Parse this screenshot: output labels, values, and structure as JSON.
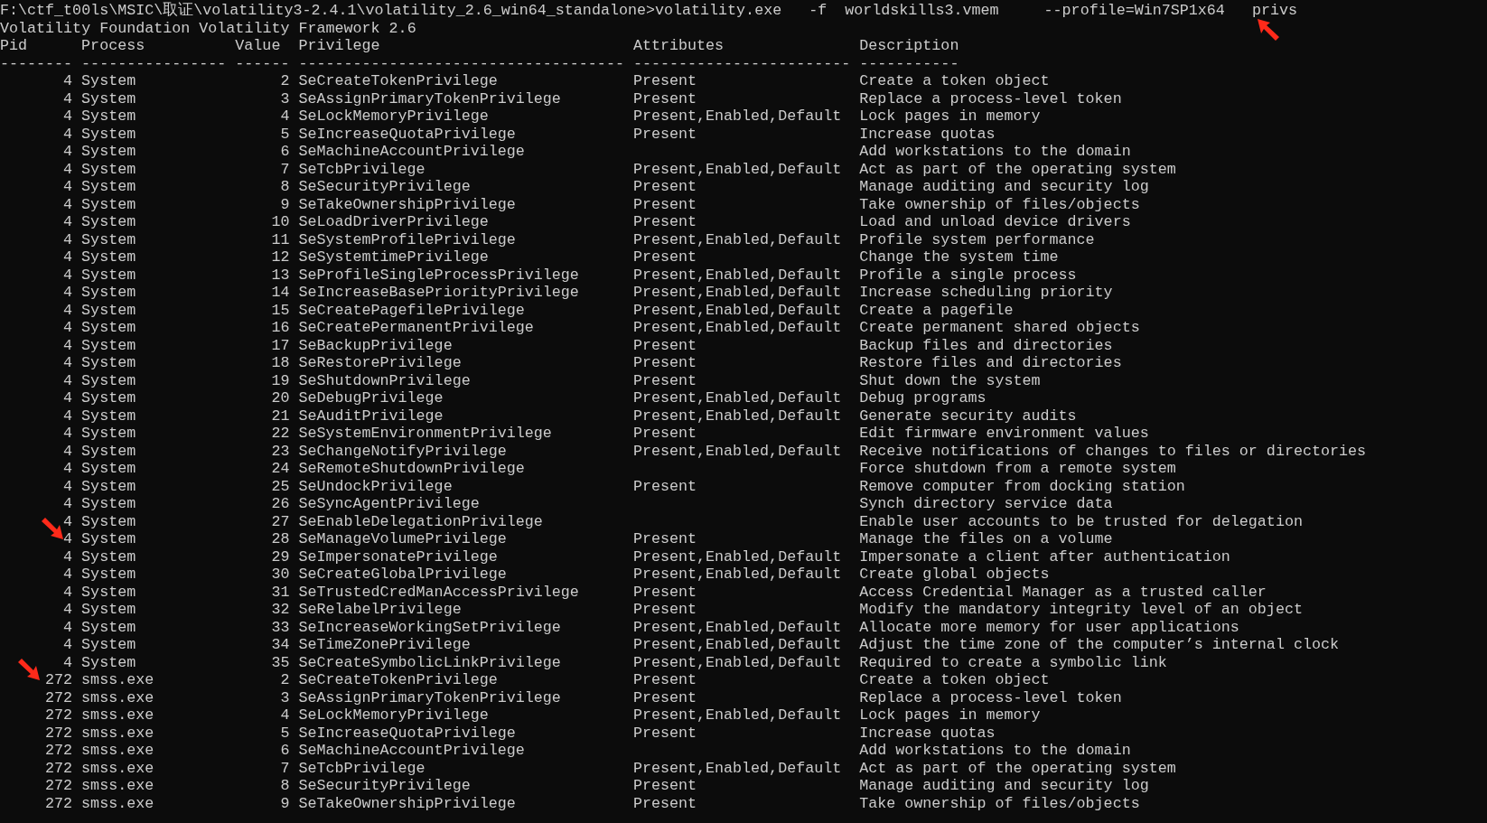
{
  "command": {
    "text": "F:\\ctf_t00ls\\MSIC\\取证\\volatility3-2.4.1\\volatility_2.6_win64_standalone>volatility.exe   -f  worldskills3.vmem     --profile=Win7SP1x64   privs",
    "arrow": true
  },
  "banner": "Volatility Foundation Volatility Framework 2.6",
  "columns": [
    {
      "label": "Pid",
      "rule": "--------"
    },
    {
      "label": "Process",
      "rule": "----------------"
    },
    {
      "label": "Value",
      "rule": "------"
    },
    {
      "label": "Privilege",
      "rule": "------------------------------------"
    },
    {
      "label": "Attributes",
      "rule": "------------------------"
    },
    {
      "label": "Description",
      "rule": "-----------"
    }
  ],
  "rows": [
    {
      "pid": "4",
      "process": "System",
      "value": "2",
      "privilege": "SeCreateTokenPrivilege",
      "attributes": "Present",
      "description": "Create a token object",
      "arrow": false
    },
    {
      "pid": "4",
      "process": "System",
      "value": "3",
      "privilege": "SeAssignPrimaryTokenPrivilege",
      "attributes": "Present",
      "description": "Replace a process-level token",
      "arrow": false
    },
    {
      "pid": "4",
      "process": "System",
      "value": "4",
      "privilege": "SeLockMemoryPrivilege",
      "attributes": "Present,Enabled,Default",
      "description": "Lock pages in memory",
      "arrow": false
    },
    {
      "pid": "4",
      "process": "System",
      "value": "5",
      "privilege": "SeIncreaseQuotaPrivilege",
      "attributes": "Present",
      "description": "Increase quotas",
      "arrow": false
    },
    {
      "pid": "4",
      "process": "System",
      "value": "6",
      "privilege": "SeMachineAccountPrivilege",
      "description": "Add workstations to the domain",
      "arrow": false
    },
    {
      "pid": "4",
      "process": "System",
      "value": "7",
      "privilege": "SeTcbPrivilege",
      "attributes": "Present,Enabled,Default",
      "description": "Act as part of the operating system",
      "arrow": false
    },
    {
      "pid": "4",
      "process": "System",
      "value": "8",
      "privilege": "SeSecurityPrivilege",
      "attributes": "Present",
      "description": "Manage auditing and security log",
      "arrow": false
    },
    {
      "pid": "4",
      "process": "System",
      "value": "9",
      "privilege": "SeTakeOwnershipPrivilege",
      "attributes": "Present",
      "description": "Take ownership of files/objects",
      "arrow": false
    },
    {
      "pid": "4",
      "process": "System",
      "value": "10",
      "privilege": "SeLoadDriverPrivilege",
      "attributes": "Present",
      "description": "Load and unload device drivers",
      "arrow": false
    },
    {
      "pid": "4",
      "process": "System",
      "value": "11",
      "privilege": "SeSystemProfilePrivilege",
      "attributes": "Present,Enabled,Default",
      "description": "Profile system performance",
      "arrow": false
    },
    {
      "pid": "4",
      "process": "System",
      "value": "12",
      "privilege": "SeSystemtimePrivilege",
      "attributes": "Present",
      "description": "Change the system time",
      "arrow": false
    },
    {
      "pid": "4",
      "process": "System",
      "value": "13",
      "privilege": "SeProfileSingleProcessPrivilege",
      "attributes": "Present,Enabled,Default",
      "description": "Profile a single process",
      "arrow": false
    },
    {
      "pid": "4",
      "process": "System",
      "value": "14",
      "privilege": "SeIncreaseBasePriorityPrivilege",
      "attributes": "Present,Enabled,Default",
      "description": "Increase scheduling priority",
      "arrow": false
    },
    {
      "pid": "4",
      "process": "System",
      "value": "15",
      "privilege": "SeCreatePagefilePrivilege",
      "attributes": "Present,Enabled,Default",
      "description": "Create a pagefile",
      "arrow": false
    },
    {
      "pid": "4",
      "process": "System",
      "value": "16",
      "privilege": "SeCreatePermanentPrivilege",
      "attributes": "Present,Enabled,Default",
      "description": "Create permanent shared objects",
      "arrow": false
    },
    {
      "pid": "4",
      "process": "System",
      "value": "17",
      "privilege": "SeBackupPrivilege",
      "attributes": "Present",
      "description": "Backup files and directories",
      "arrow": false
    },
    {
      "pid": "4",
      "process": "System",
      "value": "18",
      "privilege": "SeRestorePrivilege",
      "attributes": "Present",
      "description": "Restore files and directories",
      "arrow": false
    },
    {
      "pid": "4",
      "process": "System",
      "value": "19",
      "privilege": "SeShutdownPrivilege",
      "attributes": "Present",
      "description": "Shut down the system",
      "arrow": false
    },
    {
      "pid": "4",
      "process": "System",
      "value": "20",
      "privilege": "SeDebugPrivilege",
      "attributes": "Present,Enabled,Default",
      "description": "Debug programs",
      "arrow": false
    },
    {
      "pid": "4",
      "process": "System",
      "value": "21",
      "privilege": "SeAuditPrivilege",
      "attributes": "Present,Enabled,Default",
      "description": "Generate security audits",
      "arrow": false
    },
    {
      "pid": "4",
      "process": "System",
      "value": "22",
      "privilege": "SeSystemEnvironmentPrivilege",
      "attributes": "Present",
      "description": "Edit firmware environment values",
      "arrow": false
    },
    {
      "pid": "4",
      "process": "System",
      "value": "23",
      "privilege": "SeChangeNotifyPrivilege",
      "attributes": "Present,Enabled,Default",
      "description": "Receive notifications of changes to files or directories",
      "arrow": false
    },
    {
      "pid": "4",
      "process": "System",
      "value": "24",
      "privilege": "SeRemoteShutdownPrivilege",
      "description": "Force shutdown from a remote system",
      "arrow": false
    },
    {
      "pid": "4",
      "process": "System",
      "value": "25",
      "privilege": "SeUndockPrivilege",
      "attributes": "Present",
      "description": "Remove computer from docking station",
      "arrow": false
    },
    {
      "pid": "4",
      "process": "System",
      "value": "26",
      "privilege": "SeSyncAgentPrivilege",
      "description": "Synch directory service data",
      "arrow": false
    },
    {
      "pid": "4",
      "process": "System",
      "value": "27",
      "privilege": "SeEnableDelegationPrivilege",
      "description": "Enable user accounts to be trusted for delegation",
      "arrow": false
    },
    {
      "pid": "4",
      "process": "System",
      "value": "28",
      "privilege": "SeManageVolumePrivilege",
      "attributes": "Present",
      "description": "Manage the files on a volume",
      "arrow": true
    },
    {
      "pid": "4",
      "process": "System",
      "value": "29",
      "privilege": "SeImpersonatePrivilege",
      "attributes": "Present,Enabled,Default",
      "description": "Impersonate a client after authentication",
      "arrow": false
    },
    {
      "pid": "4",
      "process": "System",
      "value": "30",
      "privilege": "SeCreateGlobalPrivilege",
      "attributes": "Present,Enabled,Default",
      "description": "Create global objects",
      "arrow": false
    },
    {
      "pid": "4",
      "process": "System",
      "value": "31",
      "privilege": "SeTrustedCredManAccessPrivilege",
      "attributes": "Present",
      "description": "Access Credential Manager as a trusted caller",
      "arrow": false
    },
    {
      "pid": "4",
      "process": "System",
      "value": "32",
      "privilege": "SeRelabelPrivilege",
      "attributes": "Present",
      "description": "Modify the mandatory integrity level of an object",
      "arrow": false
    },
    {
      "pid": "4",
      "process": "System",
      "value": "33",
      "privilege": "SeIncreaseWorkingSetPrivilege",
      "attributes": "Present,Enabled,Default",
      "description": "Allocate more memory for user applications",
      "arrow": false
    },
    {
      "pid": "4",
      "process": "System",
      "value": "34",
      "privilege": "SeTimeZonePrivilege",
      "attributes": "Present,Enabled,Default",
      "description": "Adjust the time zone of the computer’s internal clock",
      "arrow": false
    },
    {
      "pid": "4",
      "process": "System",
      "value": "35",
      "privilege": "SeCreateSymbolicLinkPrivilege",
      "attributes": "Present,Enabled,Default",
      "description": "Required to create a symbolic link",
      "arrow": false
    },
    {
      "pid": "272",
      "process": "smss.exe",
      "value": "2",
      "privilege": "SeCreateTokenPrivilege",
      "attributes": "Present",
      "description": "Create a token object",
      "arrow": true
    },
    {
      "pid": "272",
      "process": "smss.exe",
      "value": "3",
      "privilege": "SeAssignPrimaryTokenPrivilege",
      "attributes": "Present",
      "description": "Replace a process-level token",
      "arrow": false
    },
    {
      "pid": "272",
      "process": "smss.exe",
      "value": "4",
      "privilege": "SeLockMemoryPrivilege",
      "attributes": "Present,Enabled,Default",
      "description": "Lock pages in memory",
      "arrow": false
    },
    {
      "pid": "272",
      "process": "smss.exe",
      "value": "5",
      "privilege": "SeIncreaseQuotaPrivilege",
      "attributes": "Present",
      "description": "Increase quotas",
      "arrow": false
    },
    {
      "pid": "272",
      "process": "smss.exe",
      "value": "6",
      "privilege": "SeMachineAccountPrivilege",
      "description": "Add workstations to the domain",
      "arrow": false
    },
    {
      "pid": "272",
      "process": "smss.exe",
      "value": "7",
      "privilege": "SeTcbPrivilege",
      "attributes": "Present,Enabled,Default",
      "description": "Act as part of the operating system",
      "arrow": false
    },
    {
      "pid": "272",
      "process": "smss.exe",
      "value": "8",
      "privilege": "SeSecurityPrivilege",
      "attributes": "Present",
      "description": "Manage auditing and security log",
      "arrow": false
    },
    {
      "pid": "272",
      "process": "smss.exe",
      "value": "9",
      "privilege": "SeTakeOwnershipPrivilege",
      "attributes": "Present",
      "description": "Take ownership of files/objects",
      "arrow": false
    }
  ]
}
